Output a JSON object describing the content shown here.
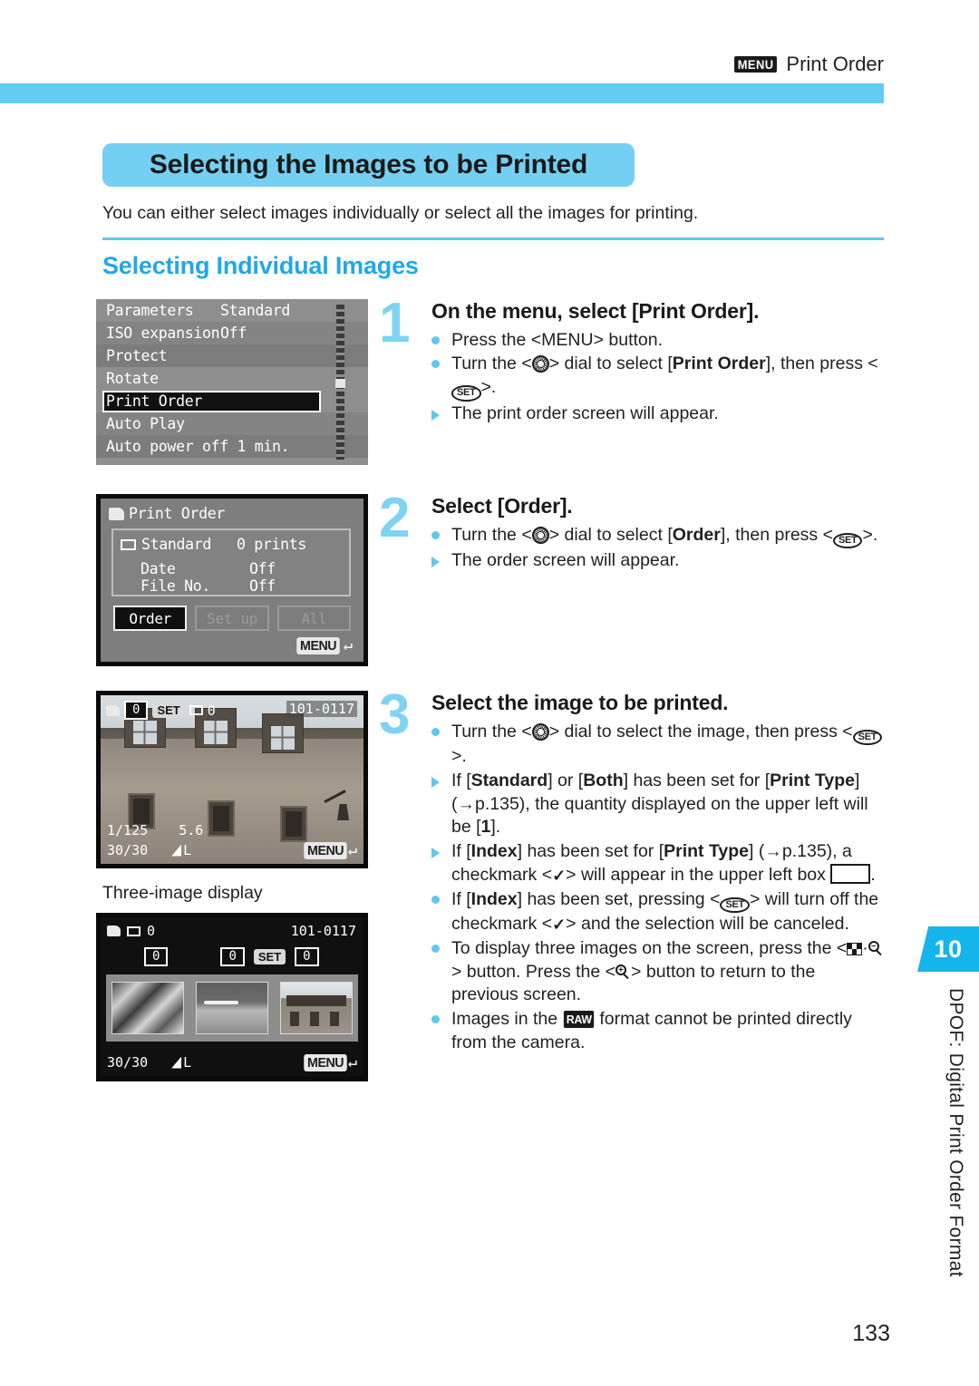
{
  "header": {
    "menu_chip": "MENU",
    "running_head": "Print Order"
  },
  "title": "Selecting the Images to be Printed",
  "lede": "You can either select images individually or select all the images for printing.",
  "section_title": "Selecting Individual Images",
  "caption_three_image": "Three-image display",
  "page_number": "133",
  "side_tab": {
    "number": "10",
    "text": "DPOF: Digital Print Order Format"
  },
  "colors": {
    "accent_cyan": "#63cbf4",
    "title_band": "#74d0f2",
    "section_blue": "#21a8e8",
    "tab_blue": "#13b5ea",
    "step_number": "#7fd3f2",
    "bullet_dot": "#5fc8ee"
  },
  "screens": {
    "menu": {
      "rows": [
        {
          "label": "Parameters",
          "value": "Standard"
        },
        {
          "label": "ISO expansion",
          "value": "Off"
        },
        {
          "label": "Protect",
          "value": ""
        },
        {
          "label": "Rotate",
          "value": ""
        },
        {
          "label": "Print Order",
          "value": "",
          "highlighted": true
        },
        {
          "label": "Auto Play",
          "value": ""
        },
        {
          "label": "Auto power off 1 min.",
          "value": ""
        }
      ]
    },
    "print_order": {
      "title": "Print Order",
      "standard_label": "Standard",
      "standard_value": "0 prints",
      "date_label": "Date",
      "date_value": "Off",
      "fileno_label": "File No.",
      "fileno_value": "Off",
      "buttons": [
        {
          "label": "Order",
          "state": "selected"
        },
        {
          "label": "Set up",
          "state": "disabled"
        },
        {
          "label": "All",
          "state": "disabled"
        }
      ],
      "menu_return": "MENU"
    },
    "single_image": {
      "print_count": "0",
      "set_chip": "SET",
      "index_count": "0",
      "file_number": "101-0117",
      "shutter": "1/125",
      "aperture": "5.6",
      "frame_counter": "30/30",
      "quality": "L",
      "menu_return": "MENU"
    },
    "three_image": {
      "index_count": "0",
      "file_number": "101-0117",
      "counts": [
        "0",
        "0",
        "0"
      ],
      "set_chip": "SET",
      "frame_counter": "30/30",
      "quality": "L",
      "menu_return": "MENU"
    }
  },
  "steps": [
    {
      "number": "1",
      "heading": "On the menu, select [Print Order].",
      "bullets": [
        {
          "marker": "dot",
          "text": "Press the <MENU> button."
        },
        {
          "marker": "dot",
          "text": "Turn the < dial-icon > dial to select [Print Order], then press < set-icon >."
        },
        {
          "marker": "triangle",
          "text": "The print order screen will appear."
        }
      ]
    },
    {
      "number": "2",
      "heading": "Select [Order].",
      "bullets": [
        {
          "marker": "dot",
          "text": "Turn the < dial-icon > dial to select [Order], then press < set-icon >."
        },
        {
          "marker": "triangle",
          "text": "The order screen will appear."
        }
      ]
    },
    {
      "number": "3",
      "heading": "Select the image to be printed.",
      "bullets": [
        {
          "marker": "dot",
          "text": "Turn the < dial-icon > dial to select the image, then press < set-icon >."
        },
        {
          "marker": "triangle",
          "text": "If [Standard] or [Both] has been set for [Print Type] (→p.135), the quantity displayed on the upper left will be [1]."
        },
        {
          "marker": "triangle",
          "text": "If [Index] has been set for [Print Type] (→p.135), a checkmark < ✓ > will appear in the upper left box □."
        },
        {
          "marker": "dot",
          "text": "If [Index] has been set, pressing < set-icon > will turn off the checkmark < ✓ > and the selection will be canceled."
        },
        {
          "marker": "dot",
          "text": "To display three images on the screen, press the < index-icon · magnify-minus-icon > button. Press the < magnify-plus-icon > button to return to the previous screen."
        },
        {
          "marker": "dot",
          "text": "Images in the RAW format cannot be printed directly from the camera."
        }
      ]
    }
  ],
  "step_text_parts": {
    "s1b1_a": "Press the <MENU> button.",
    "s1b2_a": "Turn the <",
    "s1b2_b": "> dial to select [",
    "s1b2_c": "Print Order",
    "s1b2_d": "], then press <",
    "s1b2_e": ">.",
    "s1b3": "The print order screen will appear.",
    "s2b1_a": "Turn the <",
    "s2b1_b": "> dial to select [",
    "s2b1_c": "Order",
    "s2b1_d": "], then press <",
    "s2b1_e": ">.",
    "s2b2": "The order screen will appear.",
    "s3b1_a": "Turn the <",
    "s3b1_b": "> dial to select the image, then press <",
    "s3b1_c": ">.",
    "s3b2_a": "If [",
    "s3b2_b": "Standard",
    "s3b2_c": "] or [",
    "s3b2_d": "Both",
    "s3b2_e": "] has been set for [",
    "s3b2_f": "Print Type",
    "s3b2_g": "] (→p.135), the quantity displayed on the upper left will be [",
    "s3b2_h": "1",
    "s3b2_i": "].",
    "s3b3_a": "If [",
    "s3b3_b": "Index",
    "s3b3_c": "] has been set for [",
    "s3b3_d": "Print Type",
    "s3b3_e": "] (→p.135), a checkmark <",
    "s3b3_f": "> will appear in the upper left box",
    "s3b3_g": ".",
    "s3b4_a": "If [",
    "s3b4_b": "Index",
    "s3b4_c": "] has been set, pressing <",
    "s3b4_d": "> will turn off the checkmark <",
    "s3b4_e": "> and the selection will be canceled.",
    "s3b5_a": "To display three images on the screen, press the <",
    "s3b5_b": "> button. Press the <",
    "s3b5_c": "> button to return to the previous screen.",
    "s3b6_a": "Images in the",
    "s3b6_b": "RAW",
    "s3b6_c": "format cannot be printed directly from the camera."
  }
}
